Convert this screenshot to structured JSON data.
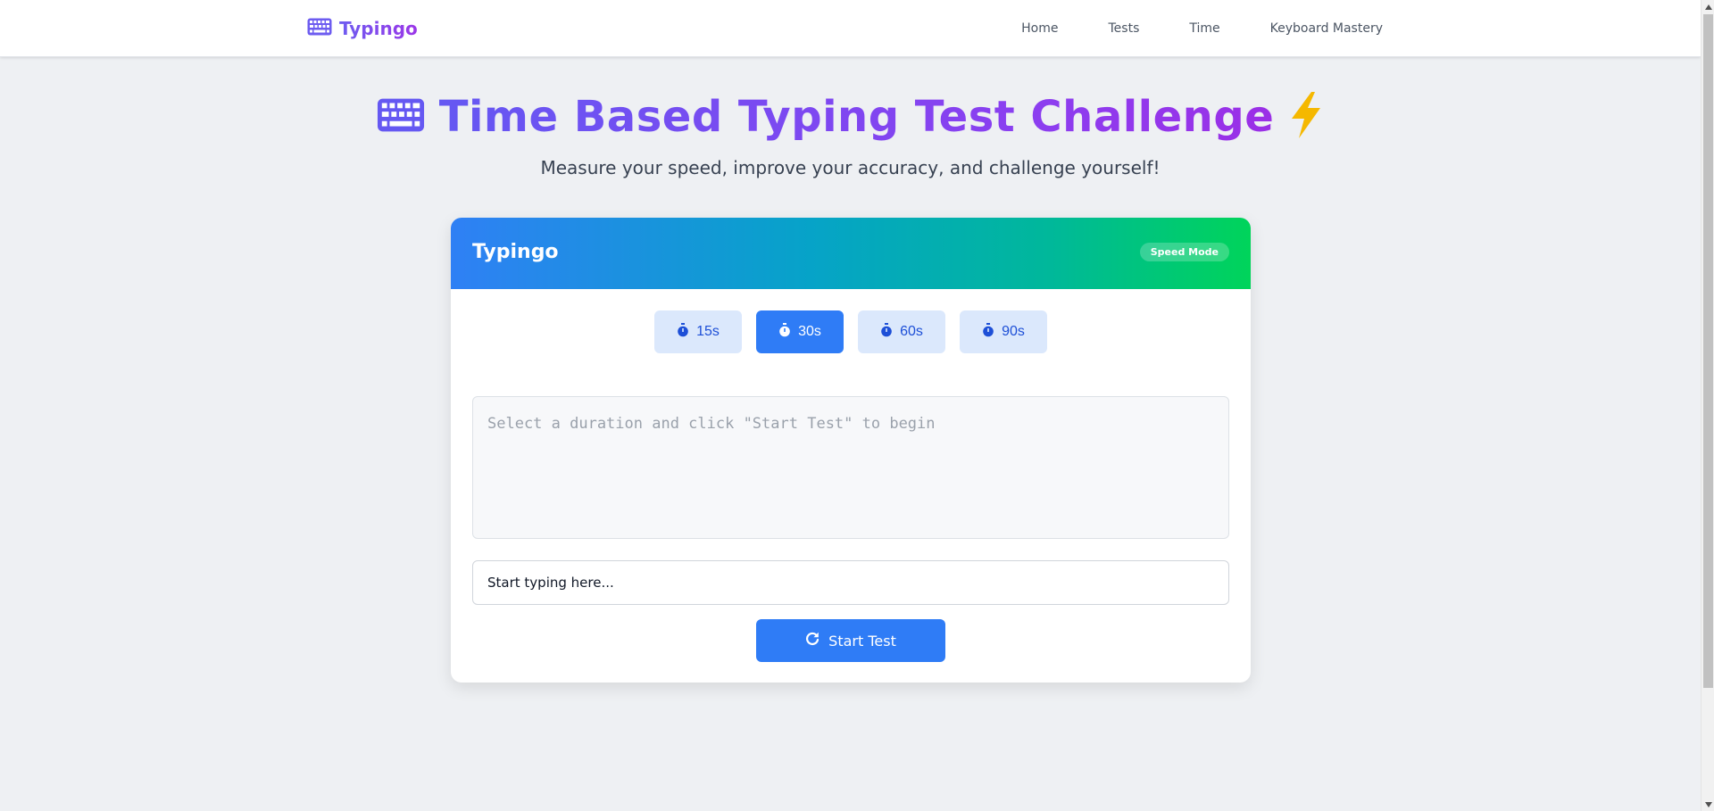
{
  "nav": {
    "brand": "Typingo",
    "links": [
      "Home",
      "Tests",
      "Time",
      "Keyboard Mastery"
    ]
  },
  "hero": {
    "title": "Time Based Typing Test Challenge",
    "subtitle": "Measure your speed, improve your accuracy, and challenge yourself!"
  },
  "card": {
    "title": "Typingo",
    "mode_badge": "Speed Mode",
    "durations": [
      "15s",
      "30s",
      "60s",
      "90s"
    ],
    "selected_duration": "30s",
    "prompt_text": "Select a duration and click \"Start Test\" to begin",
    "input_placeholder": "Start typing here...",
    "start_button": "Start Test"
  },
  "colors": {
    "accent": "#2f7cf6",
    "brand_purple": "#7c4ef0",
    "duration_bg": "#dbe8fc",
    "lightning": "#f5b800"
  },
  "icons": {
    "brand": "keyboard-icon",
    "hero_left": "keyboard-icon",
    "hero_right": "lightning-icon",
    "duration": "stopwatch-icon",
    "start": "redo-icon"
  }
}
